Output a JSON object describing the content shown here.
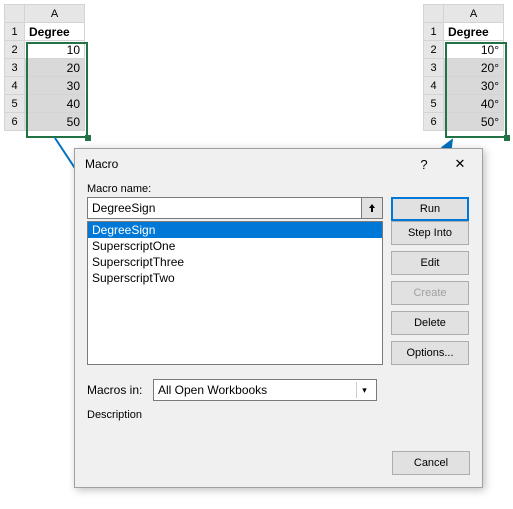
{
  "grid_left": {
    "col": "A",
    "rows": [
      "1",
      "2",
      "3",
      "4",
      "5",
      "6"
    ],
    "header": "Degree",
    "cells": [
      "10",
      "20",
      "30",
      "40",
      "50"
    ]
  },
  "grid_right": {
    "col": "A",
    "rows": [
      "1",
      "2",
      "3",
      "4",
      "5",
      "6"
    ],
    "header": "Degree",
    "cells": [
      "10°",
      "20°",
      "30°",
      "40°",
      "50°"
    ]
  },
  "dialog": {
    "title": "Macro",
    "help": "?",
    "close": "✕",
    "name_label": "Macro name:",
    "name_value": "DegreeSign",
    "list": [
      "DegreeSign",
      "SuperscriptOne",
      "SuperscriptThree",
      "SuperscriptTwo"
    ],
    "buttons": {
      "run": "Run",
      "step": "Step Into",
      "edit": "Edit",
      "create": "Create",
      "delete": "Delete",
      "options": "Options..."
    },
    "macros_in_label": "Macros in:",
    "macros_in_value": "All Open Workbooks",
    "description_label": "Description",
    "cancel": "Cancel"
  }
}
